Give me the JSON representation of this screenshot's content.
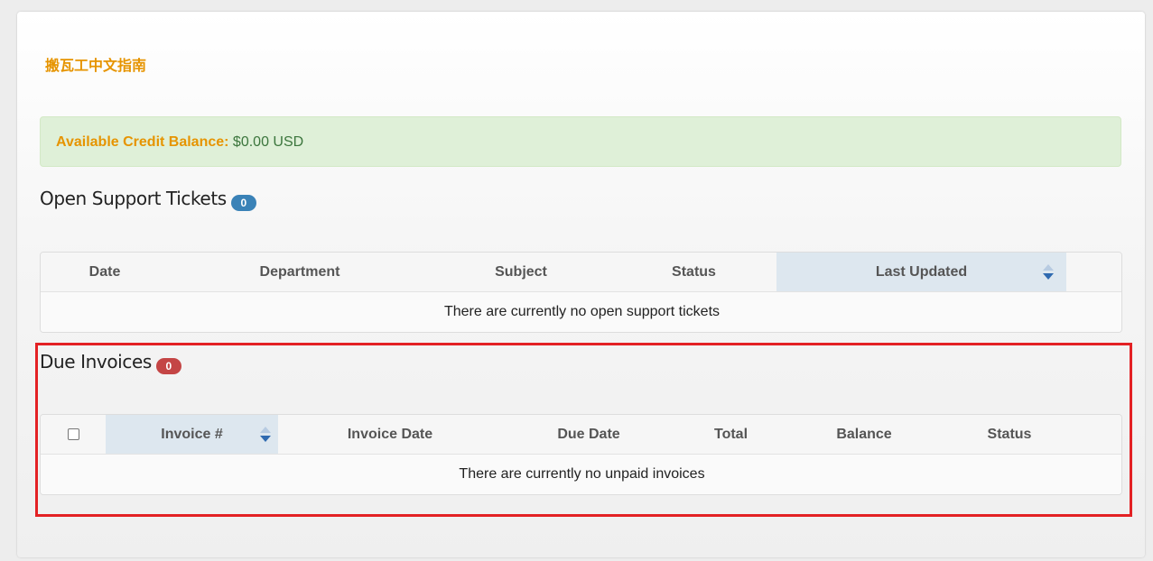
{
  "brand": {
    "title": "搬瓦工中文指南"
  },
  "credit": {
    "label": "Available Credit Balance:",
    "value": " $0.00 USD"
  },
  "tickets": {
    "title": "Open Support Tickets",
    "count": "0",
    "columns": [
      "Date",
      "Department",
      "Subject",
      "Status",
      "Last Updated"
    ],
    "empty_message": "There are currently no open support tickets"
  },
  "invoices": {
    "title": "Due Invoices",
    "count": "0",
    "columns": [
      "Invoice #",
      "Invoice Date",
      "Due Date",
      "Total",
      "Balance",
      "Status"
    ],
    "empty_message": "There are currently no unpaid invoices"
  },
  "colors": {
    "brand": "#e69400",
    "credit_bg": "#dff0d8",
    "credit_text": "#3c763d",
    "badge_blue": "#3a82b7",
    "badge_red": "#c44545",
    "sorted_header": "#dde7ef",
    "highlight": "#e32124"
  },
  "icons": {
    "sort": "sort-icon",
    "checkbox": "checkbox-icon"
  }
}
